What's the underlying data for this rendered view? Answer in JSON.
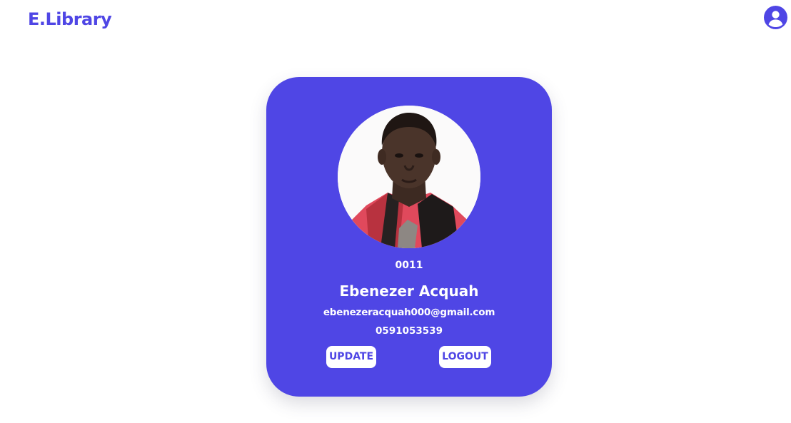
{
  "header": {
    "brand": "E.Library",
    "profile_icon": "user-circle-icon"
  },
  "profile_card": {
    "photo_alt": "profile photo",
    "user_id": "0011",
    "name": "Ebenezer Acquah",
    "email": "ebenezeracquah000@gmail.com",
    "phone": "0591053539",
    "update_label": "UPDATE",
    "logout_label": "LOGOUT"
  },
  "colors": {
    "accent": "#4f46e5",
    "background": "#ffffff",
    "card_text": "#ffffff"
  }
}
